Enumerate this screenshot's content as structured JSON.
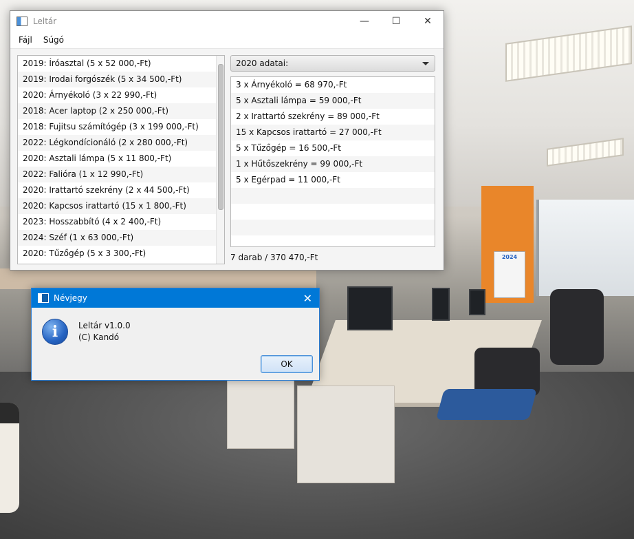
{
  "window": {
    "title": "Leltár",
    "controls": {
      "minimize": "—",
      "maximize": "☐",
      "close": "✕"
    }
  },
  "menu": [
    "Fájl",
    "Súgó"
  ],
  "inventory_list": [
    "2019: Íróasztal (5 x 52 000,-Ft)",
    "2019: Irodai forgószék (5 x 34 500,-Ft)",
    "2020: Árnyékoló (3 x 22 990,-Ft)",
    "2018: Acer laptop (2 x 250 000,-Ft)",
    "2018: Fujitsu számítógép (3 x 199 000,-Ft)",
    "2022: Légkondícionáló (2 x 280 000,-Ft)",
    "2020: Asztali lámpa (5 x 11 800,-Ft)",
    "2022: Falióra (1 x 12 990,-Ft)",
    "2020: Irattartó szekrény (2 x 44 500,-Ft)",
    "2020: Kapcsos irattartó (15 x 1 800,-Ft)",
    "2023: Hosszabbító (4 x 2 400,-Ft)",
    "2024: Széf (1 x 63 000,-Ft)",
    "2020: Tűzőgép (5 x 3 300,-Ft)"
  ],
  "year_select": {
    "selected": "2020 adatai:"
  },
  "year_details": [
    "3 x Árnyékoló = 68 970,-Ft",
    "5 x Asztali lámpa = 59 000,-Ft",
    "2 x Irattartó szekrény = 89 000,-Ft",
    "15 x Kapcsos irattartó = 27 000,-Ft",
    "5 x Tűzőgép = 16 500,-Ft",
    "1 x Hűtőszekrény = 99 000,-Ft",
    "5 x Egérpad = 11 000,-Ft"
  ],
  "summary": "7 darab / 370 470,-Ft",
  "dialog": {
    "title": "Névjegy",
    "icon": "i",
    "line1": "Leltár v1.0.0",
    "line2": "(C) Kandó",
    "ok_label": "OK",
    "close": "✕"
  },
  "calendar_year": "2024"
}
